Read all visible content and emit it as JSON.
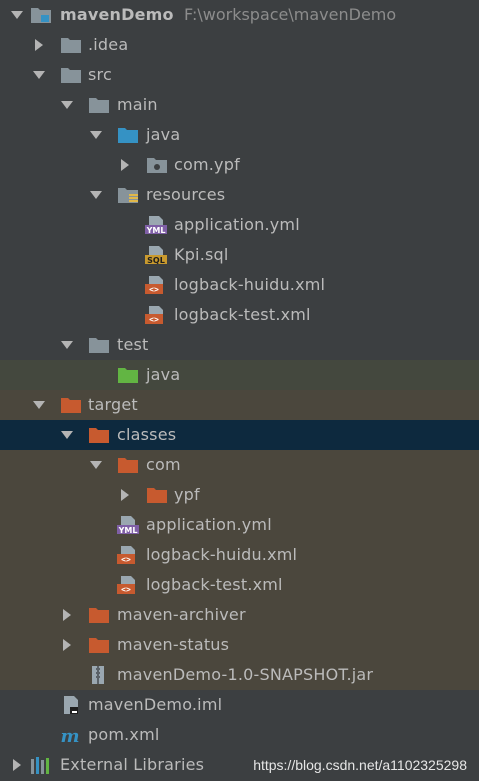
{
  "project": {
    "name": "mavenDemo",
    "path": "F:\\workspace\\mavenDemo"
  },
  "tree": {
    "idea": ".idea",
    "src": "src",
    "main": "main",
    "main_java": "java",
    "com_ypf_package": "com.ypf",
    "resources": "resources",
    "res_application_yml": "application.yml",
    "res_kpi_sql": "Kpi.sql",
    "res_logback_huidu": "logback-huidu.xml",
    "res_logback_test": "logback-test.xml",
    "test": "test",
    "test_java": "java",
    "target": "target",
    "classes": "classes",
    "classes_com": "com",
    "classes_ypf": "ypf",
    "classes_application_yml": "application.yml",
    "classes_logback_huidu": "logback-huidu.xml",
    "classes_logback_test": "logback-test.xml",
    "maven_archiver": "maven-archiver",
    "maven_status": "maven-status",
    "jar": "mavenDemo-1.0-SNAPSHOT.jar",
    "iml": "mavenDemo.iml",
    "pom": "pom.xml",
    "external_libraries": "External Libraries"
  },
  "icon_labels": {
    "yml": "YML",
    "sql": "SQL",
    "xml": "<>"
  },
  "watermark": "https://blog.csdn.net/a1102325298",
  "colors": {
    "panel_bg": "#3c3f41",
    "excluded_bg": "#4b473d",
    "test_bg": "#44483e",
    "selected_bg": "#0d293e",
    "folder_gray": "#87939a",
    "folder_source": "#3592c4",
    "folder_test": "#62b543",
    "folder_excluded": "#c75a2f",
    "text": "#bbbbbb"
  }
}
